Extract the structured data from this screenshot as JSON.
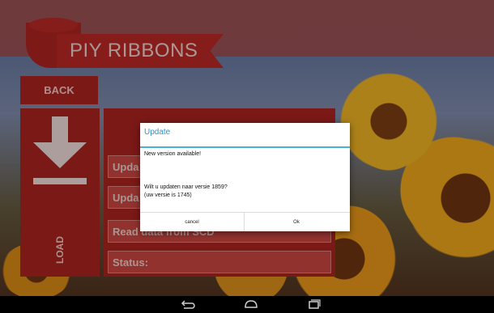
{
  "app": {
    "title": "PIY RIBBONS"
  },
  "controls": {
    "back_label": "BACK",
    "load_label": "LOAD",
    "rows": [
      {
        "label": "Upda"
      },
      {
        "label": "Upda"
      },
      {
        "label": "Read data from SCD"
      },
      {
        "label": "Status:"
      }
    ]
  },
  "dialog": {
    "title": "Update",
    "line1": "New version available!",
    "line2": "Wilt u updaten naar versie 1859?",
    "line3": "(uw versie is 1745)",
    "cancel_label": "cancel",
    "ok_label": "Ok"
  },
  "navbar": {
    "icons": [
      "back-icon",
      "home-icon",
      "recents-icon"
    ]
  },
  "colors": {
    "brand_red": "#a21c19",
    "dialog_accent": "#2a94c8"
  }
}
